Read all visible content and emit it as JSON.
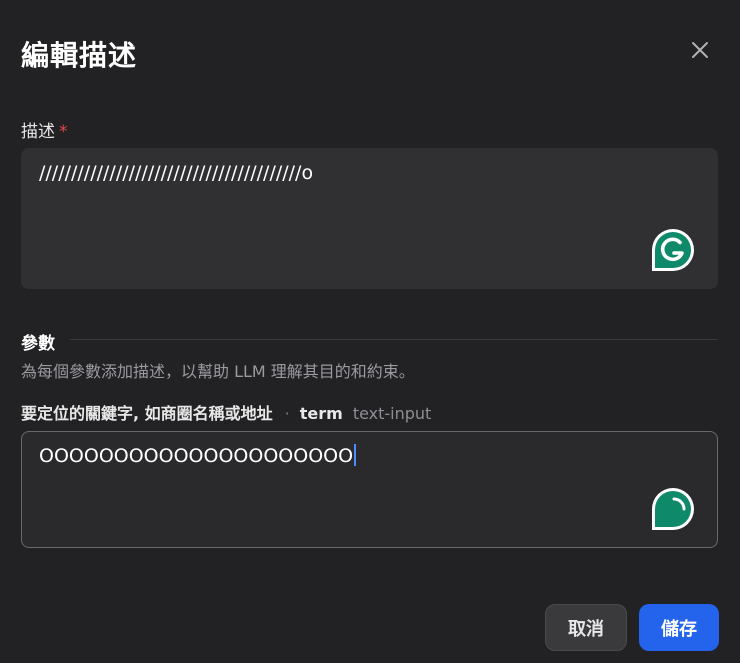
{
  "dialog": {
    "title": "編輯描述"
  },
  "description": {
    "label": "描述",
    "required_mark": "*",
    "value": "/////////////////////////////////////////o"
  },
  "params": {
    "section_title": "參數",
    "section_desc": "為每個參數添加描述，以幫助 LLM 理解其目的和約束。",
    "items": [
      {
        "label": "要定位的關鍵字, 如商圈名稱或地址",
        "separator": "·",
        "key": "term",
        "type": "text-input",
        "value": "OOOOOOOOOOOOOOOOOOOOO"
      }
    ]
  },
  "actions": {
    "cancel_label": "取消",
    "save_label": "儲存"
  },
  "colors": {
    "background": "#222224",
    "primary": "#2463eb",
    "required": "#e5484d",
    "grammarly": "#0e8a6a"
  },
  "icons": {
    "close": "close-icon",
    "grammarly": "grammarly-icon"
  }
}
